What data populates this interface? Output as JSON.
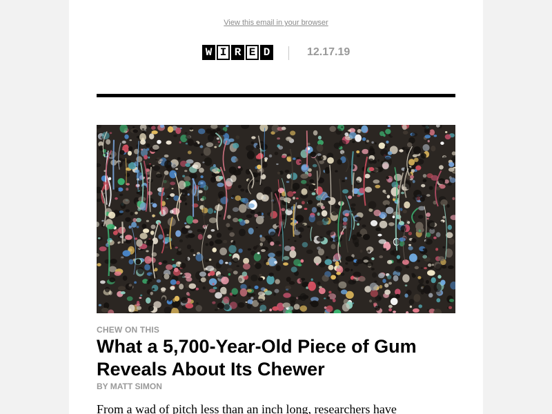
{
  "email": {
    "view_in_browser": "View this email in your browser"
  },
  "masthead": {
    "logo_letters": [
      "W",
      "I",
      "R",
      "E",
      "D"
    ],
    "date": "12.17.19"
  },
  "hero_image": {
    "icon": "gum-wall-photo"
  },
  "article": {
    "kicker": "CHEW ON THIS",
    "headline": "What a 5,700-Year-Old Piece of Gum Reveals About Its Chewer",
    "byline": "BY MATT SIMON",
    "body_start": "From a wad of pitch less than an inch long, researchers have"
  },
  "colors": {
    "page_bg": "#f2f2f2",
    "content_bg": "#ffffff",
    "muted_text": "#999999",
    "rule": "#000000"
  }
}
